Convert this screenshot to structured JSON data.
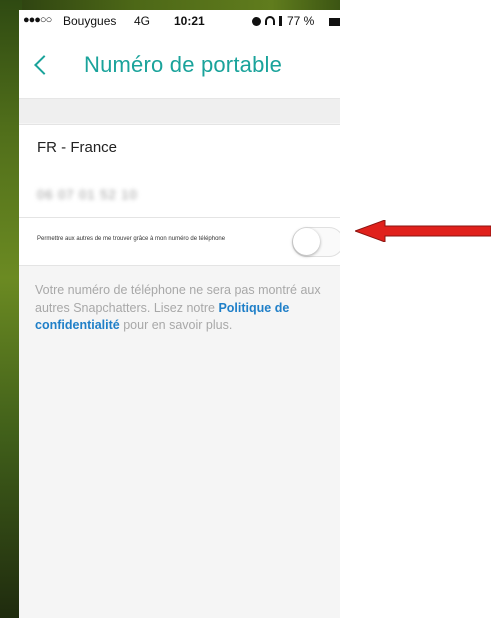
{
  "status_bar": {
    "signal_dots": "●●●○○",
    "carrier": "Bouygues",
    "network": "4G",
    "time": "10:21",
    "battery": "77 %"
  },
  "nav": {
    "title": "Numéro de portable"
  },
  "country": {
    "value": "FR - France"
  },
  "phone": {
    "value": "06 07 01 52 10"
  },
  "toggle_row": {
    "label": "Permettre aux autres de me trouver grâce à mon numéro de téléphone",
    "state": "off"
  },
  "footer": {
    "text_before": "Votre numéro de téléphone ne sera pas montré aux autres Snapchatters. Lisez notre ",
    "link": "Politique de confidentialité",
    "text_after": " pour en savoir plus."
  },
  "colors": {
    "accent": "#1aa39b",
    "link": "#1f7fc8",
    "annotation_arrow": "#e0211c"
  }
}
